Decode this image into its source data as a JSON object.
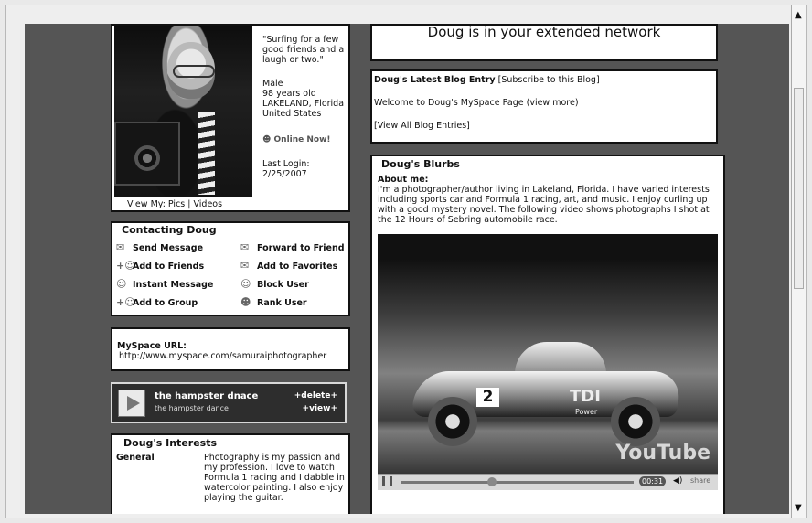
{
  "profile": {
    "quote": "\"Surfing for a few good friends and a laugh or two.\"",
    "gender": "Male",
    "age": "98 years old",
    "city": "LAKELAND, Florida",
    "country": "United States",
    "online": "Online Now!",
    "last_login_label": "Last Login:",
    "last_login": "2/25/2007",
    "view_my": "View My: Pics | Videos"
  },
  "contact": {
    "title": "Contacting Doug",
    "actions": [
      {
        "label": "Send Message",
        "icon": "envelope-icon"
      },
      {
        "label": "Forward to Friend",
        "icon": "forward-envelope-icon"
      },
      {
        "label": "Add to Friends",
        "icon": "add-friend-icon"
      },
      {
        "label": "Add to Favorites",
        "icon": "favorites-icon"
      },
      {
        "label": "Instant Message",
        "icon": "im-icon"
      },
      {
        "label": "Block User",
        "icon": "block-user-icon"
      },
      {
        "label": "Add to Group",
        "icon": "add-group-icon"
      },
      {
        "label": "Rank User",
        "icon": "rank-user-icon"
      }
    ]
  },
  "url": {
    "label": "MySpace URL:",
    "value": "http://www.myspace.com/samuraiphotographer"
  },
  "music": {
    "title": "the hampster dnace",
    "subtitle": "the hampster dance",
    "delete": "+delete+",
    "view": "+view+"
  },
  "interests": {
    "title": "Doug's Interests",
    "category": "General",
    "text": "Photography is my passion and my profession. I love to watch Formula 1 racing and I dabble in watercolor painting. I also enjoy playing the guitar."
  },
  "network": {
    "text": "Doug is in your extended network"
  },
  "blog": {
    "title": "Doug's Latest Blog Entry",
    "subscribe": "[Subscribe to this Blog]",
    "entry": "Welcome to Doug's MySpace Page",
    "view_more": "(view more)",
    "view_all": "[View All Blog Entries]"
  },
  "blurbs": {
    "title": "Doug's Blurbs",
    "about_label": "About me:",
    "about": "I'm a photographer/author living in Lakeland, Florida. I have varied interests including sports car and Formula 1 racing, art, and music. I enjoy curling up with a good mystery novel. The following video shows photographs I shot at the 12 Hours of Sebring automobile race."
  },
  "video": {
    "car_number": "2",
    "car_sponsor": "TDI",
    "car_sponsor_sub": "Power",
    "watermark": "YouTube",
    "time": "00:31",
    "share": "share"
  }
}
